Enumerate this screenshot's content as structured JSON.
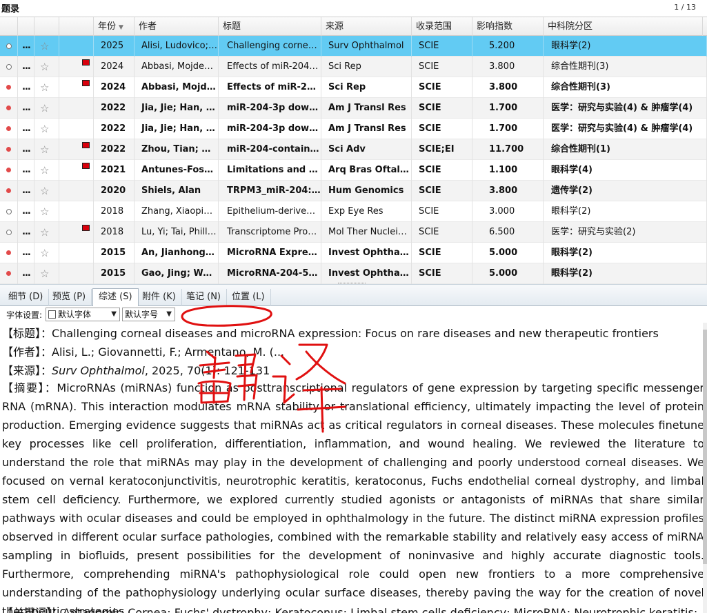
{
  "header": {
    "title": "题录",
    "pager": "1 / 13"
  },
  "table": {
    "columns": [
      "",
      "",
      "",
      "",
      "年份",
      "作者",
      "标题",
      "来源",
      "收录范围",
      "影响指数",
      "中科院分区"
    ],
    "rows": [
      {
        "read": "empty",
        "more": "...",
        "flag": false,
        "bold": false,
        "sel": true,
        "year": "2025",
        "author": "Alisi, Ludovico; ...",
        "title": "Challenging corneal...",
        "source": "Surv Ophthalmol",
        "scope": "SCIE",
        "impact": "5.200",
        "zone": "眼科学(2)"
      },
      {
        "read": "empty",
        "more": "...",
        "flag": true,
        "bold": false,
        "sel": false,
        "year": "2024",
        "author": "Abbasi, Mojdeh;...",
        "title": "Effects of miR-204-...",
        "source": "Sci Rep",
        "scope": "SCIE",
        "impact": "3.800",
        "zone": "综合性期刊(3)"
      },
      {
        "read": "red",
        "more": "...",
        "flag": true,
        "bold": true,
        "sel": false,
        "year": "2024",
        "author": "Abbasi, Mojdeh;",
        "title": "Effects of miR-204-...",
        "source": "Sci Rep",
        "scope": "SCIE",
        "impact": "3.800",
        "zone": "综合性期刊(3)"
      },
      {
        "read": "red",
        "more": "...",
        "flag": false,
        "bold": true,
        "sel": false,
        "year": "2022",
        "author": "Jia, Jie; Han, Yua",
        "title": "miR-204-3p downr...",
        "source": "Am J Transl Res",
        "scope": "SCIE",
        "impact": "1.700",
        "zone": "医学：研究与实验(4) & 肿瘤学(4)"
      },
      {
        "read": "red",
        "more": "...",
        "flag": false,
        "bold": true,
        "sel": false,
        "year": "2022",
        "author": "Jia, Jie; Han, Yua",
        "title": "miR-204-3p downr...",
        "source": "Am J Transl Res",
        "scope": "SCIE",
        "impact": "1.700",
        "zone": "医学：研究与实验(4) & 肿瘤学(4)"
      },
      {
        "read": "red",
        "more": "...",
        "flag": true,
        "bold": true,
        "sel": false,
        "year": "2022",
        "author": "Zhou, Tian; He, ...",
        "title": "miR-204-containing",
        "source": "Sci Adv",
        "scope": "SCIE;EI",
        "impact": "11.700",
        "zone": "综合性期刊(1)"
      },
      {
        "read": "red",
        "more": "...",
        "flag": true,
        "bold": true,
        "sel": false,
        "year": "2021",
        "author": "Antunes-Foschi...",
        "title": "Limitations and adv...",
        "source": "Arq Bras Oftalmo",
        "scope": "SCIE",
        "impact": "1.100",
        "zone": "眼科学(4)"
      },
      {
        "read": "red",
        "more": "...",
        "flag": false,
        "bold": true,
        "sel": false,
        "year": "2020",
        "author": "Shiels, Alan",
        "title": "TRPM3_miR-204: a ...",
        "source": "Hum Genomics",
        "scope": "SCIE",
        "impact": "3.800",
        "zone": "遗传学(2)"
      },
      {
        "read": "empty",
        "more": "...",
        "flag": false,
        "bold": false,
        "sel": false,
        "year": "2018",
        "author": "Zhang, Xiaoping...",
        "title": "Epithelium-derived ...",
        "source": "Exp Eye Res",
        "scope": "SCIE",
        "impact": "3.000",
        "zone": "眼科学(2)"
      },
      {
        "read": "empty",
        "more": "...",
        "flag": true,
        "bold": false,
        "sel": false,
        "year": "2018",
        "author": "Lu, Yi; Tai, Philli...",
        "title": "Transcriptome Profil...",
        "source": "Mol Ther Nucleic...",
        "scope": "SCIE",
        "impact": "6.500",
        "zone": "医学：研究与实验(2)"
      },
      {
        "read": "red",
        "more": "...",
        "flag": false,
        "bold": true,
        "sel": false,
        "year": "2015",
        "author": "An, Jianhong; C.",
        "title": "MicroRNA Expressi...",
        "source": "Invest Ophthalm...",
        "scope": "SCIE",
        "impact": "5.000",
        "zone": "眼科学(2)"
      },
      {
        "read": "red",
        "more": "...",
        "flag": false,
        "bold": true,
        "sel": false,
        "year": "2015",
        "author": "Gao, Jing; Wang",
        "title": "MicroRNA-204-5p-...",
        "source": "Invest Ophthalm...",
        "scope": "SCIE",
        "impact": "5.000",
        "zone": "眼科学(2)"
      }
    ]
  },
  "tabs": [
    "细节 (D)",
    "预览 (P)",
    "综述 (S)",
    "附件 (K)",
    "笔记 (N)",
    "位置 (L)"
  ],
  "font_settings": {
    "label": "字体设置:",
    "font": "默认字体",
    "size": "默认字号"
  },
  "detail": {
    "title_label": "【标题】：",
    "title": "Challenging corneal diseases and microRNA expression: Focus on rare diseases and new therapeutic frontiers",
    "author_label": "【作者】：",
    "author": "Alisi, L.; Giovannetti, F.; Armentano, M. (...",
    "source_label": "【来源】：",
    "source_journal": "Surv Ophthalmol",
    "source_rest": ", 2025, 70(1): 121-131",
    "abstract_label": "【摘要】：",
    "abstract": "MicroRNAs (miRNAs) function as posttranscriptional regulators of gene expression  by targeting specific messenger RNA (mRNA). This interaction modulates mRNA  stability or translational efficiency, ultimately impacting the level of protein  production. Emerging evidence suggests that miRNAs act as critical regulators in  corneal diseases. These molecules finetune key processes like cell proliferation,  differentiation, inflammation, and wound healing. We reviewed the literature to  understand the role that miRNAs may play in the development of challenging and  poorly understood corneal diseases. We focused on vernal keratoconjunctivitis, neurotrophic keratitis, keratoconus, Fuchs endothelial corneal dystrophy, and  limbal stem cell deficiency. Furthermore, we explored currently studied agonists  or antagonists of miRNAs that share similar pathways with ocular diseases and  could be employed in ophthalmology in the future. The distinct miRNA expression  profiles observed in different ocular surface pathologies, combined with the  remarkable stability and relatively easy access of miRNA sampling in biofluids,  present possibilities for the development of noninvasive and highly accurate  diagnostic tools. Furthermore, comprehending miRNA's pathophysiological role  could open new frontiers to a more comprehensive understanding of the  pathophysiology underlying ocular surface diseases, thereby paving the way for  the creation of novel therapeutic strategies.",
    "keywords_label": "【关键词】：",
    "keywords": "Antagomir; Cornea; Fuchs' dystrophy; Keratoconus; Limbal stem cells deficiency; MicroRNA; Neurotrophic keratitis;"
  },
  "annotation": {
    "handwriting": "翻译",
    "color": "#e01010"
  }
}
